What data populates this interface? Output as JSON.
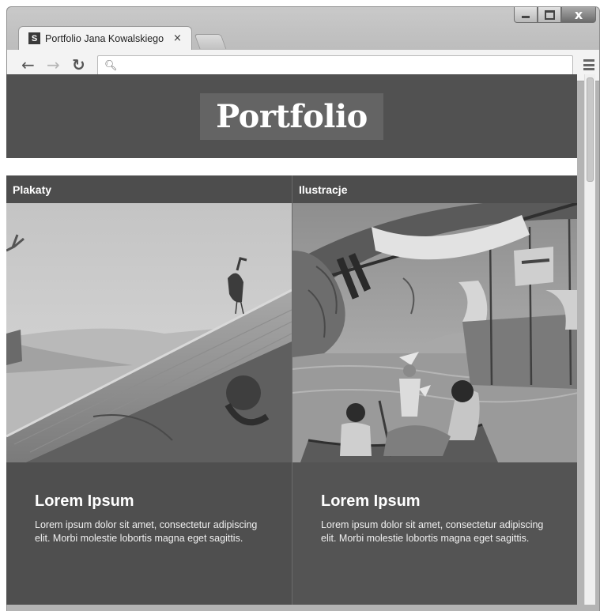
{
  "browser": {
    "tab_title": "Portfolio Jana Kowalskiego",
    "favicon_letter": "S",
    "tab_close": "×",
    "address_value": "",
    "window_close": "x"
  },
  "site": {
    "logo": "Portfolio"
  },
  "cards": [
    {
      "label": "Plakaty",
      "title": "Lorem Ipsum",
      "text": "Lorem ipsum dolor sit amet, consectetur adipiscing elit. Morbi molestie lobortis magna eget sagittis."
    },
    {
      "label": "Ilustracje",
      "title": "Lorem Ipsum",
      "text": "Lorem ipsum dolor sit amet, consectetur adipiscing elit. Morbi molestie lobortis magna eget sagittis."
    }
  ],
  "icons": {
    "back": "arrow-left-icon",
    "forward": "arrow-right-icon",
    "reload": "reload-icon",
    "search": "search-icon",
    "menu": "menu-icon"
  }
}
